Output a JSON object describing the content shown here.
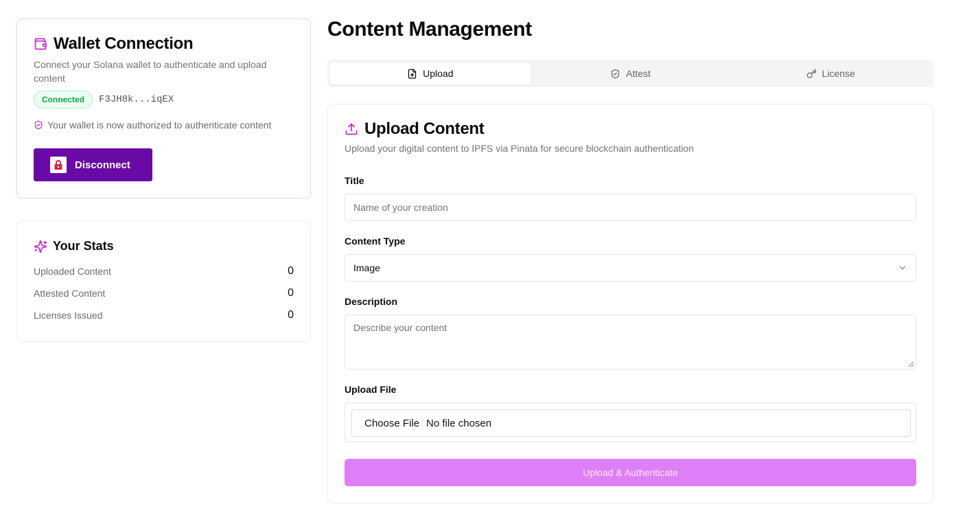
{
  "colors": {
    "accent": "#c026d3",
    "button_purple": "#6a0aa6",
    "submit_bg": "#de7ff7",
    "connected_green": "#16a34a"
  },
  "wallet": {
    "icon": "wallet-icon",
    "title": "Wallet Connection",
    "description": "Connect your Solana wallet to authenticate and upload content",
    "status_badge": "Connected",
    "address": "F3JH8k...iqEX",
    "auth_message": "Your wallet is now authorized to authenticate content",
    "disconnect_label": "Disconnect"
  },
  "stats": {
    "icon": "sparkles-icon",
    "title": "Your Stats",
    "items": [
      {
        "label": "Uploaded Content",
        "value": "0"
      },
      {
        "label": "Attested Content",
        "value": "0"
      },
      {
        "label": "Licenses Issued",
        "value": "0"
      }
    ]
  },
  "main": {
    "title": "Content Management",
    "tabs": [
      {
        "label": "Upload",
        "icon": "file-upload-icon",
        "active": true
      },
      {
        "label": "Attest",
        "icon": "shield-icon",
        "active": false
      },
      {
        "label": "License",
        "icon": "key-icon",
        "active": false
      }
    ]
  },
  "upload": {
    "icon": "upload-icon",
    "title": "Upload Content",
    "description": "Upload your digital content to IPFS via Pinata for secure blockchain authentication",
    "title_label": "Title",
    "title_placeholder": "Name of your creation",
    "type_label": "Content Type",
    "type_value": "Image",
    "description_label": "Description",
    "description_placeholder": "Describe your content",
    "file_label": "Upload File",
    "file_button": "Choose File",
    "file_status": "No file chosen",
    "submit_label": "Upload & Authenticate"
  }
}
